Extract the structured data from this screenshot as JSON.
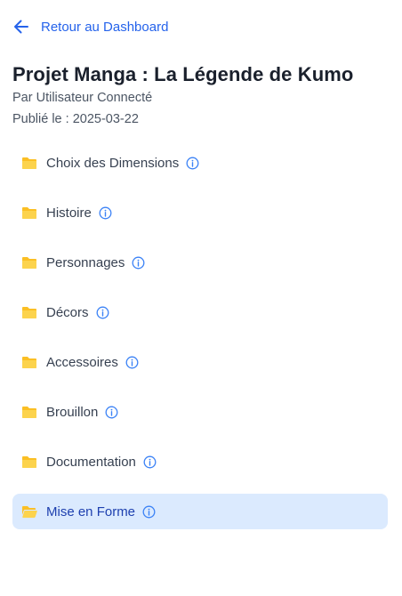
{
  "nav": {
    "back_label": "Retour au Dashboard"
  },
  "project": {
    "title": "Projet Manga : La Légende de Kumo",
    "author_line": "Par Utilisateur Connecté",
    "published_label": "Publié le :",
    "published_date": "2025-03-22"
  },
  "folders": [
    {
      "label": "Choix des Dimensions",
      "active": false
    },
    {
      "label": "Histoire",
      "active": false
    },
    {
      "label": "Personnages",
      "active": false
    },
    {
      "label": "Décors",
      "active": false
    },
    {
      "label": "Accessoires",
      "active": false
    },
    {
      "label": "Brouillon",
      "active": false
    },
    {
      "label": "Documentation",
      "active": false
    },
    {
      "label": "Mise en Forme",
      "active": true
    }
  ],
  "colors": {
    "accent": "#2563eb",
    "folder": "#fbbf24",
    "active_bg": "#dbeafe",
    "info": "#3b82f6"
  },
  "icons": {
    "back": "arrow-left-icon",
    "folder": "folder-icon",
    "info": "info-icon"
  }
}
